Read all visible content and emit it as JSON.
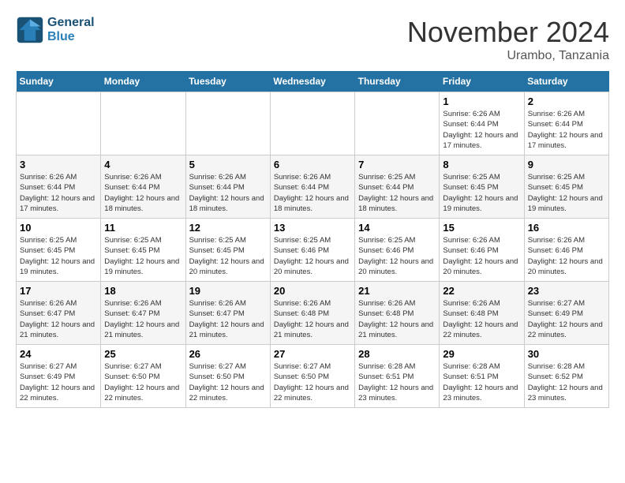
{
  "logo": {
    "line1": "General",
    "line2": "Blue"
  },
  "title": "November 2024",
  "location": "Urambo, Tanzania",
  "days_of_week": [
    "Sunday",
    "Monday",
    "Tuesday",
    "Wednesday",
    "Thursday",
    "Friday",
    "Saturday"
  ],
  "weeks": [
    [
      {
        "day": "",
        "info": ""
      },
      {
        "day": "",
        "info": ""
      },
      {
        "day": "",
        "info": ""
      },
      {
        "day": "",
        "info": ""
      },
      {
        "day": "",
        "info": ""
      },
      {
        "day": "1",
        "info": "Sunrise: 6:26 AM\nSunset: 6:44 PM\nDaylight: 12 hours and 17 minutes."
      },
      {
        "day": "2",
        "info": "Sunrise: 6:26 AM\nSunset: 6:44 PM\nDaylight: 12 hours and 17 minutes."
      }
    ],
    [
      {
        "day": "3",
        "info": "Sunrise: 6:26 AM\nSunset: 6:44 PM\nDaylight: 12 hours and 17 minutes."
      },
      {
        "day": "4",
        "info": "Sunrise: 6:26 AM\nSunset: 6:44 PM\nDaylight: 12 hours and 18 minutes."
      },
      {
        "day": "5",
        "info": "Sunrise: 6:26 AM\nSunset: 6:44 PM\nDaylight: 12 hours and 18 minutes."
      },
      {
        "day": "6",
        "info": "Sunrise: 6:26 AM\nSunset: 6:44 PM\nDaylight: 12 hours and 18 minutes."
      },
      {
        "day": "7",
        "info": "Sunrise: 6:25 AM\nSunset: 6:44 PM\nDaylight: 12 hours and 18 minutes."
      },
      {
        "day": "8",
        "info": "Sunrise: 6:25 AM\nSunset: 6:45 PM\nDaylight: 12 hours and 19 minutes."
      },
      {
        "day": "9",
        "info": "Sunrise: 6:25 AM\nSunset: 6:45 PM\nDaylight: 12 hours and 19 minutes."
      }
    ],
    [
      {
        "day": "10",
        "info": "Sunrise: 6:25 AM\nSunset: 6:45 PM\nDaylight: 12 hours and 19 minutes."
      },
      {
        "day": "11",
        "info": "Sunrise: 6:25 AM\nSunset: 6:45 PM\nDaylight: 12 hours and 19 minutes."
      },
      {
        "day": "12",
        "info": "Sunrise: 6:25 AM\nSunset: 6:45 PM\nDaylight: 12 hours and 20 minutes."
      },
      {
        "day": "13",
        "info": "Sunrise: 6:25 AM\nSunset: 6:46 PM\nDaylight: 12 hours and 20 minutes."
      },
      {
        "day": "14",
        "info": "Sunrise: 6:25 AM\nSunset: 6:46 PM\nDaylight: 12 hours and 20 minutes."
      },
      {
        "day": "15",
        "info": "Sunrise: 6:26 AM\nSunset: 6:46 PM\nDaylight: 12 hours and 20 minutes."
      },
      {
        "day": "16",
        "info": "Sunrise: 6:26 AM\nSunset: 6:46 PM\nDaylight: 12 hours and 20 minutes."
      }
    ],
    [
      {
        "day": "17",
        "info": "Sunrise: 6:26 AM\nSunset: 6:47 PM\nDaylight: 12 hours and 21 minutes."
      },
      {
        "day": "18",
        "info": "Sunrise: 6:26 AM\nSunset: 6:47 PM\nDaylight: 12 hours and 21 minutes."
      },
      {
        "day": "19",
        "info": "Sunrise: 6:26 AM\nSunset: 6:47 PM\nDaylight: 12 hours and 21 minutes."
      },
      {
        "day": "20",
        "info": "Sunrise: 6:26 AM\nSunset: 6:48 PM\nDaylight: 12 hours and 21 minutes."
      },
      {
        "day": "21",
        "info": "Sunrise: 6:26 AM\nSunset: 6:48 PM\nDaylight: 12 hours and 21 minutes."
      },
      {
        "day": "22",
        "info": "Sunrise: 6:26 AM\nSunset: 6:48 PM\nDaylight: 12 hours and 22 minutes."
      },
      {
        "day": "23",
        "info": "Sunrise: 6:27 AM\nSunset: 6:49 PM\nDaylight: 12 hours and 22 minutes."
      }
    ],
    [
      {
        "day": "24",
        "info": "Sunrise: 6:27 AM\nSunset: 6:49 PM\nDaylight: 12 hours and 22 minutes."
      },
      {
        "day": "25",
        "info": "Sunrise: 6:27 AM\nSunset: 6:50 PM\nDaylight: 12 hours and 22 minutes."
      },
      {
        "day": "26",
        "info": "Sunrise: 6:27 AM\nSunset: 6:50 PM\nDaylight: 12 hours and 22 minutes."
      },
      {
        "day": "27",
        "info": "Sunrise: 6:27 AM\nSunset: 6:50 PM\nDaylight: 12 hours and 22 minutes."
      },
      {
        "day": "28",
        "info": "Sunrise: 6:28 AM\nSunset: 6:51 PM\nDaylight: 12 hours and 23 minutes."
      },
      {
        "day": "29",
        "info": "Sunrise: 6:28 AM\nSunset: 6:51 PM\nDaylight: 12 hours and 23 minutes."
      },
      {
        "day": "30",
        "info": "Sunrise: 6:28 AM\nSunset: 6:52 PM\nDaylight: 12 hours and 23 minutes."
      }
    ]
  ]
}
